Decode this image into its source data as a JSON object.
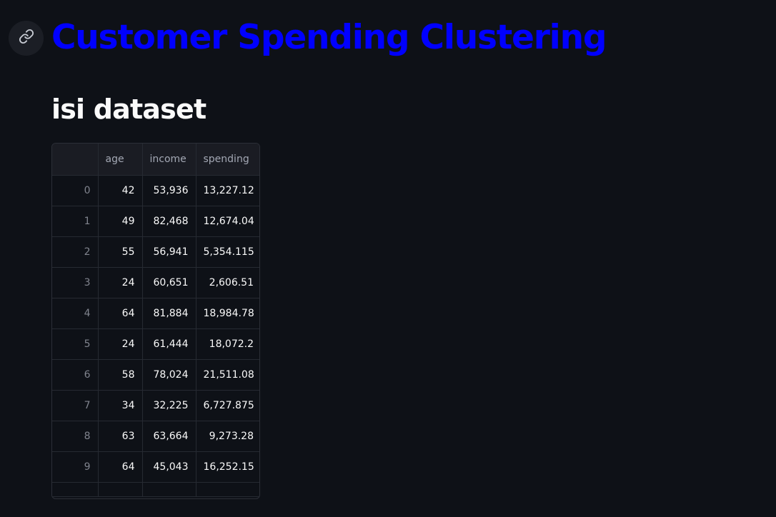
{
  "page": {
    "title": "Customer Spending Clustering",
    "subheader": "isi dataset",
    "title_color": "#0000ff"
  },
  "icons": {
    "anchor_link": "link-icon"
  },
  "table": {
    "columns": [
      "",
      "age",
      "income",
      "spending"
    ],
    "rows": [
      [
        "0",
        "42",
        "53,936",
        "13,227.12"
      ],
      [
        "1",
        "49",
        "82,468",
        "12,674.04"
      ],
      [
        "2",
        "55",
        "56,941",
        "5,354.115"
      ],
      [
        "3",
        "24",
        "60,651",
        "2,606.51"
      ],
      [
        "4",
        "64",
        "81,884",
        "18,984.78"
      ],
      [
        "5",
        "24",
        "61,444",
        "18,072.2"
      ],
      [
        "6",
        "58",
        "78,024",
        "21,511.08"
      ],
      [
        "7",
        "34",
        "32,225",
        "6,727.875"
      ],
      [
        "8",
        "63",
        "63,664",
        "9,273.28"
      ],
      [
        "9",
        "64",
        "45,043",
        "16,252.15"
      ]
    ]
  }
}
